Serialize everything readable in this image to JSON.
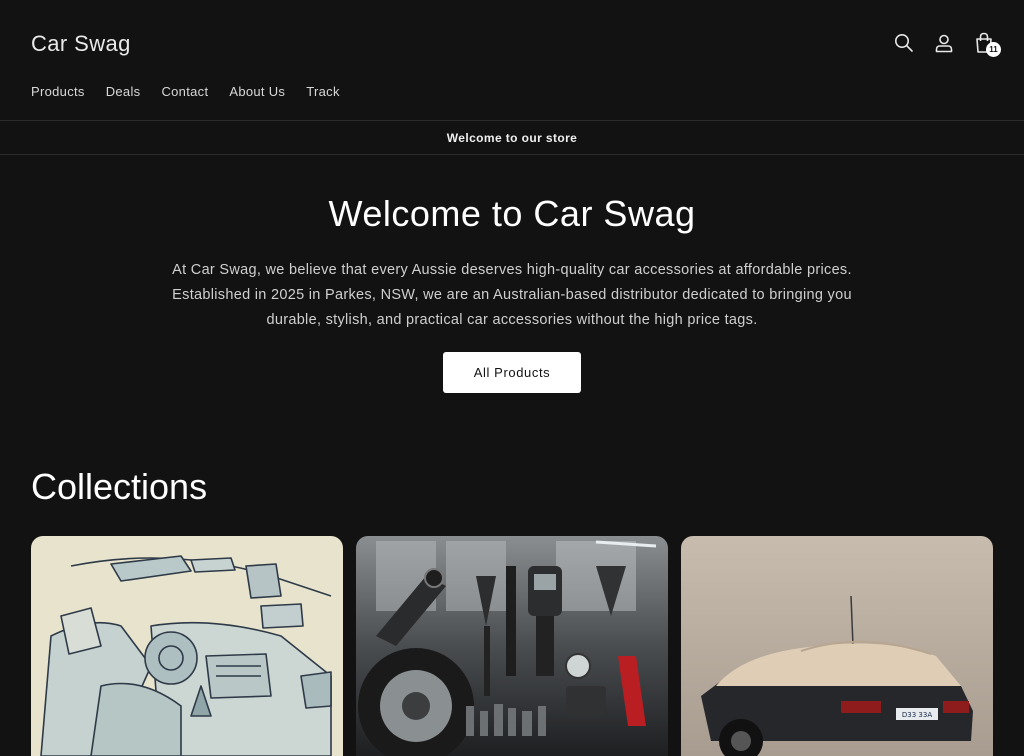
{
  "header": {
    "brand": "Car Swag",
    "nav": [
      "Products",
      "Deals",
      "Contact",
      "About Us",
      "Track"
    ],
    "icons": [
      "search-icon",
      "account-icon",
      "cart-icon"
    ],
    "cart_count": "11"
  },
  "announcement": "Welcome to our store",
  "hero": {
    "title": "Welcome to Car Swag",
    "text": "At Car Swag, we believe that every Aussie deserves high-quality car accessories at affordable prices. Established in 2025 in Parkes, NSW, we are an Australian-based distributor dedicated to bringing you durable, stylish, and practical car accessories without the high price tags.",
    "button": "All Products"
  },
  "collections": {
    "title": "Collections",
    "plate_text": "D33 33A"
  },
  "colors": {
    "background": "#121212",
    "text": "#ffffff",
    "button_bg": "#ffffff"
  }
}
